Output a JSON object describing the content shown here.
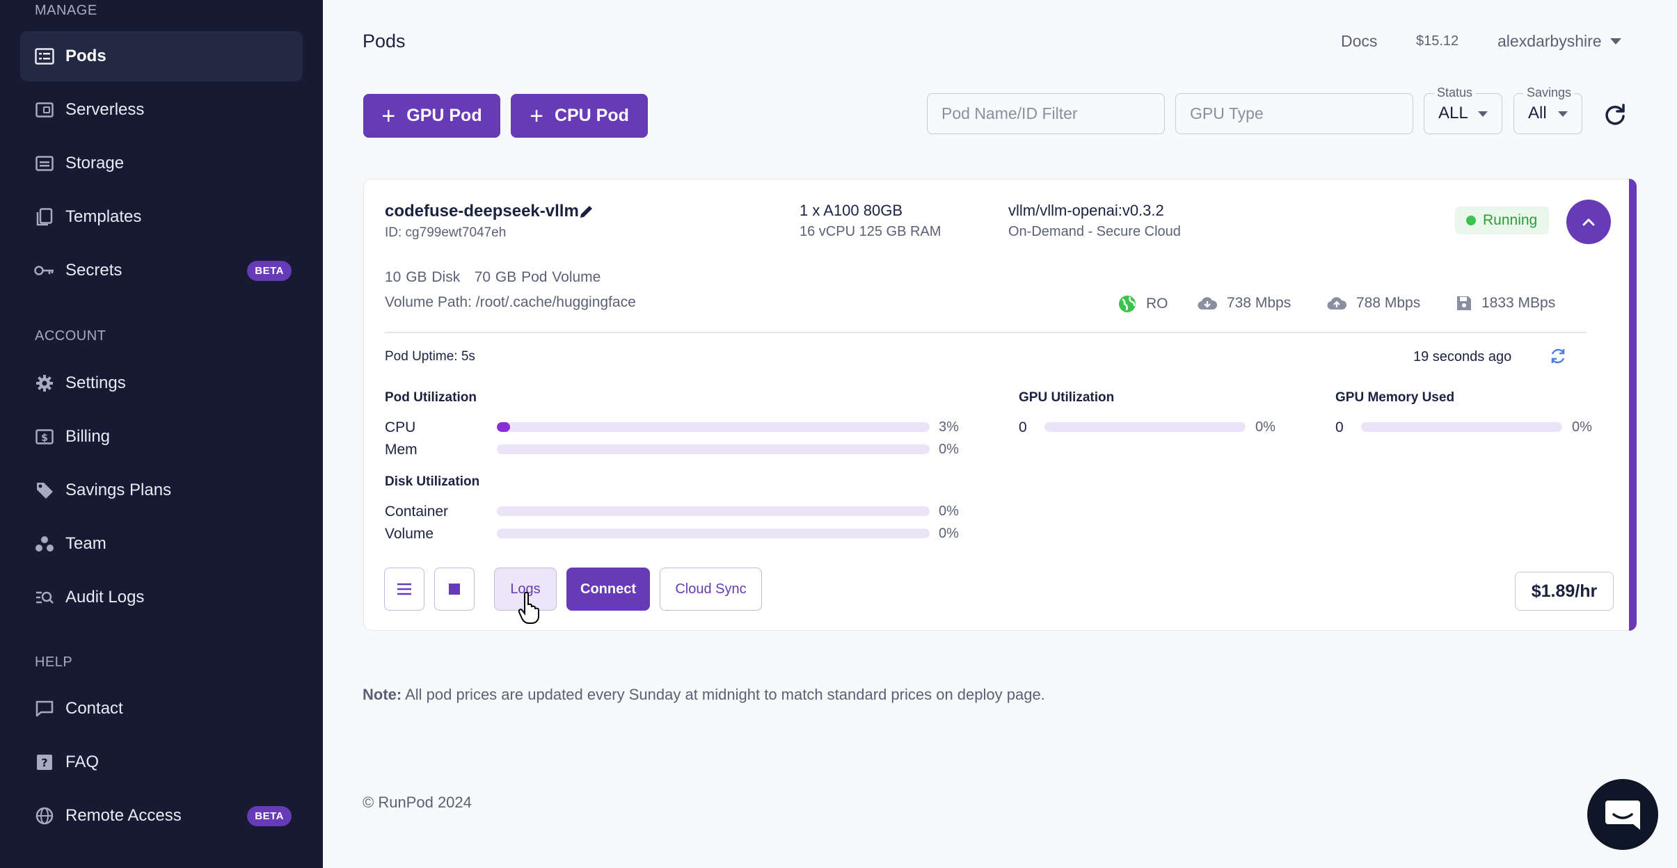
{
  "sidebar": {
    "sections": {
      "manage": "MANAGE",
      "account": "ACCOUNT",
      "help": "HELP"
    },
    "items": {
      "pods": {
        "label": "Pods",
        "icon": "pods-icon",
        "active": true
      },
      "serverless": {
        "label": "Serverless",
        "icon": "serverless-icon"
      },
      "storage": {
        "label": "Storage",
        "icon": "storage-icon"
      },
      "templates": {
        "label": "Templates",
        "icon": "templates-icon"
      },
      "secrets": {
        "label": "Secrets",
        "icon": "key-icon",
        "badge": "BETA"
      },
      "settings": {
        "label": "Settings",
        "icon": "gear-icon"
      },
      "billing": {
        "label": "Billing",
        "icon": "billing-icon"
      },
      "savings_plans": {
        "label": "Savings Plans",
        "icon": "tag-icon"
      },
      "team": {
        "label": "Team",
        "icon": "team-icon"
      },
      "audit_logs": {
        "label": "Audit Logs",
        "icon": "audit-logs-icon"
      },
      "contact": {
        "label": "Contact",
        "icon": "chat-icon"
      },
      "faq": {
        "label": "FAQ",
        "icon": "faq-icon"
      },
      "remote_access": {
        "label": "Remote Access",
        "icon": "globe-icon",
        "badge": "BETA"
      }
    }
  },
  "header": {
    "title": "Pods",
    "docs": "Docs",
    "balance": "$15.12",
    "user": "alexdarbyshire"
  },
  "toolbar": {
    "gpu_pod": "GPU Pod",
    "cpu_pod": "CPU Pod",
    "name_filter_placeholder": "Pod Name/ID Filter",
    "gpu_type_placeholder": "GPU Type",
    "status_label": "Status",
    "status_value": "ALL",
    "savings_label": "Savings",
    "savings_value": "All"
  },
  "pod": {
    "name": "codefuse-deepseek-vllm",
    "id": "ID: cg799ewt7047eh",
    "gpu": "1 x A100 80GB",
    "specs": "16 vCPU 125 GB RAM",
    "image": "vllm/vllm-openai:v0.3.2",
    "cloud": "On-Demand - Secure Cloud",
    "status": "Running",
    "disk": "10 GB Disk",
    "volume": "70 GB Pod Volume",
    "volume_path": "Volume Path: /root/.cache/huggingface",
    "network": {
      "region": "RO",
      "download": "738 Mbps",
      "upload": "788 Mbps",
      "disk_speed": "1833 MBps"
    },
    "uptime": "Pod Uptime: 5s",
    "updated": "19 seconds ago",
    "pod_utilization": {
      "title": "Pod Utilization",
      "cpu_label": "CPU",
      "cpu_value": "3%",
      "cpu_fraction": 0.03,
      "mem_label": "Mem",
      "mem_value": "0%",
      "mem_fraction": 0
    },
    "disk_utilization": {
      "title": "Disk Utilization",
      "container_label": "Container",
      "container_value": "0%",
      "container_fraction": 0,
      "volume_label": "Volume",
      "volume_value": "0%",
      "volume_fraction": 0
    },
    "gpu_utilization": {
      "title": "GPU Utilization",
      "index": "0",
      "value": "0%",
      "fraction": 0
    },
    "gpu_memory": {
      "title": "GPU Memory Used",
      "index": "0",
      "value": "0%",
      "fraction": 0
    },
    "actions": {
      "logs": "Logs",
      "connect": "Connect",
      "cloud_sync": "Cloud Sync"
    },
    "price": "$1.89/hr"
  },
  "note": {
    "label": "Note:",
    "text": " All pod prices are updated every Sunday at midnight to match standard prices on deploy page."
  },
  "footer": {
    "copyright": "© RunPod 2024"
  },
  "colors": {
    "sidebar_bg": "#161b33",
    "accent": "#673ab7",
    "running": "#3cc34a"
  }
}
